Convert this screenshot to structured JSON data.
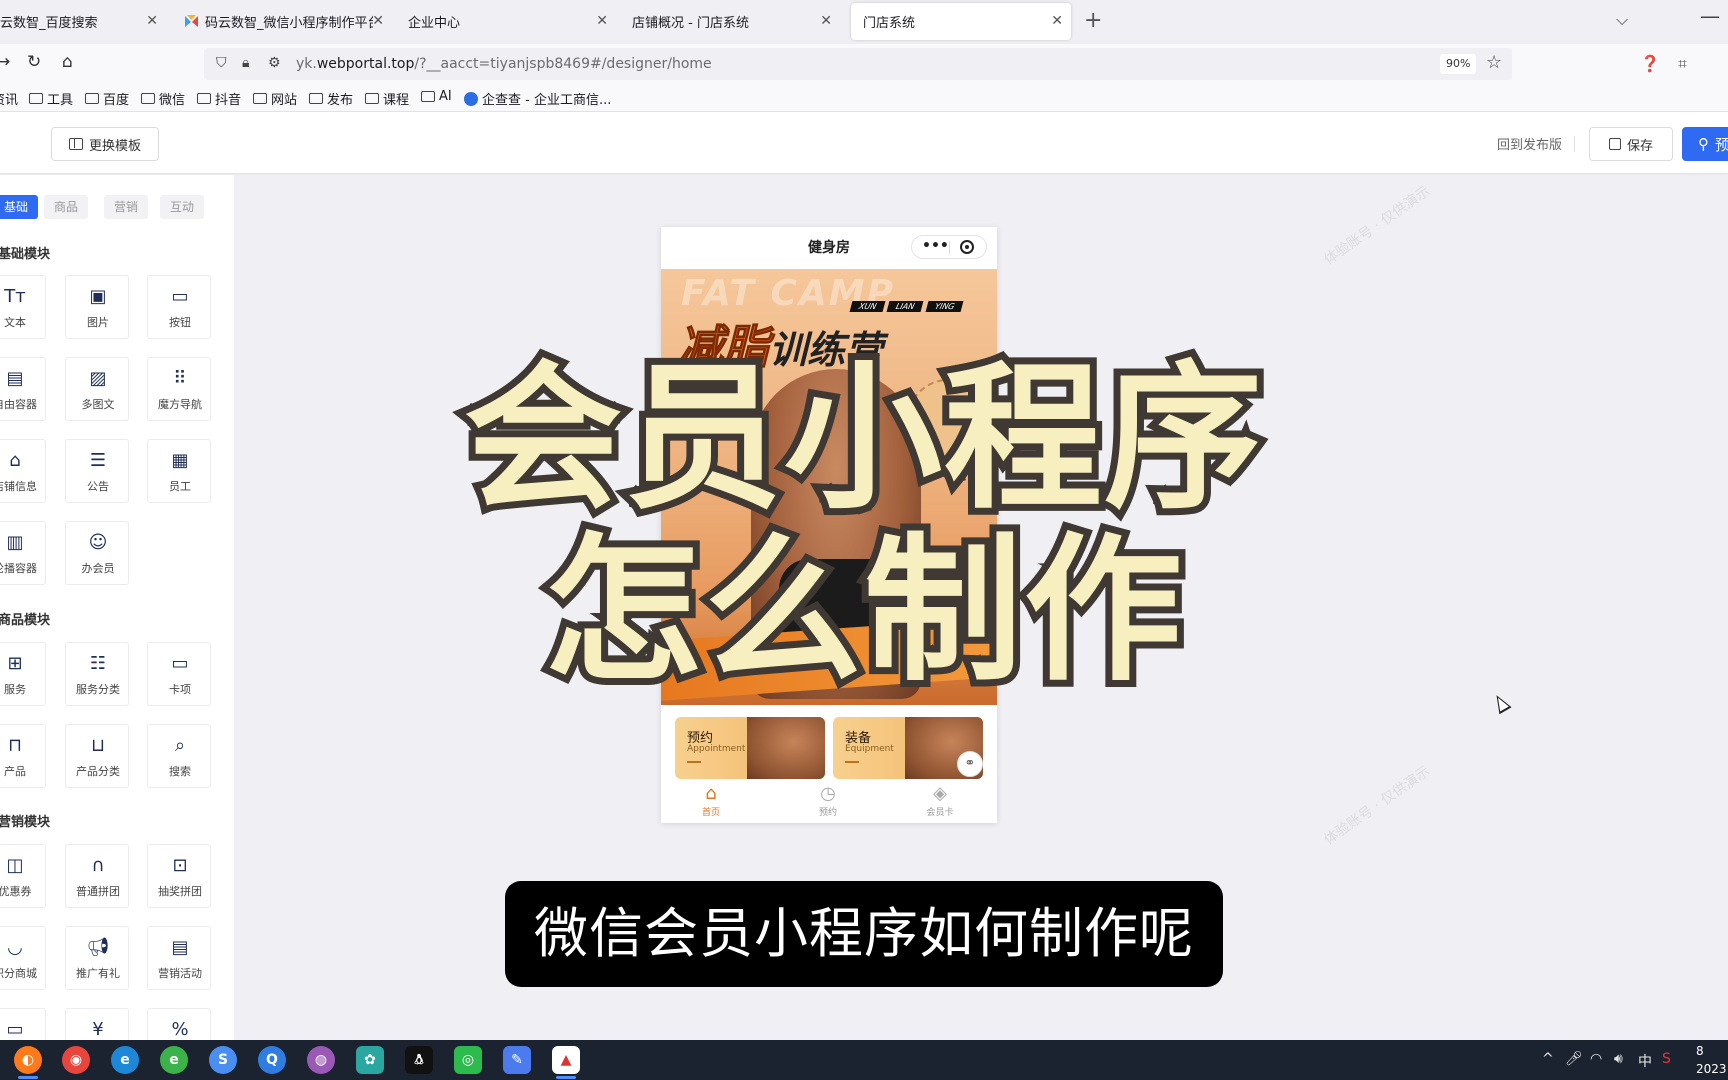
{
  "browser": {
    "tabs": [
      {
        "label": "云数智_百度搜索",
        "active": false
      },
      {
        "label": "码云数智_微信小程序制作平台_",
        "active": false
      },
      {
        "label": "企业中心",
        "active": false
      },
      {
        "label": "店铺概况 - 门店系统",
        "active": false
      },
      {
        "label": "门店系统",
        "active": true
      }
    ],
    "url_prefix": "yk.",
    "url_domain": "webportal.top",
    "url_path": "/?__aacct=tiyanjspb8469#/designer/home",
    "zoom": "90%",
    "bookmarks": [
      {
        "label": "资讯",
        "type": "folder"
      },
      {
        "label": "工具",
        "type": "folder"
      },
      {
        "label": "百度",
        "type": "folder"
      },
      {
        "label": "微信",
        "type": "folder"
      },
      {
        "label": "抖音",
        "type": "folder"
      },
      {
        "label": "网站",
        "type": "folder"
      },
      {
        "label": "发布",
        "type": "folder"
      },
      {
        "label": "课程",
        "type": "folder"
      },
      {
        "label": "AI",
        "type": "folder"
      },
      {
        "label": "企查查 - 企业工商信...",
        "type": "site"
      }
    ]
  },
  "header": {
    "template_button": "更换模板",
    "publish_link": "回到发布版",
    "save_button": "保存",
    "preview_button": "预"
  },
  "left_panel": {
    "tabs": [
      {
        "label": "基础",
        "active": true
      },
      {
        "label": "商品",
        "active": false
      },
      {
        "label": "营销",
        "active": false
      },
      {
        "label": "互动",
        "active": false
      }
    ],
    "sections": [
      {
        "title": "基础模块",
        "items": [
          {
            "label": "文本",
            "icon": "text-icon"
          },
          {
            "label": "图片",
            "icon": "image-icon"
          },
          {
            "label": "按钮",
            "icon": "button-icon"
          },
          {
            "label": "自由容器",
            "icon": "container-icon"
          },
          {
            "label": "多图文",
            "icon": "multi-image-icon"
          },
          {
            "label": "魔方导航",
            "icon": "grid-nav-icon"
          },
          {
            "label": "店铺信息",
            "icon": "store-icon"
          },
          {
            "label": "公告",
            "icon": "notice-icon"
          },
          {
            "label": "员工",
            "icon": "staff-card-icon"
          },
          {
            "label": "轮播容器",
            "icon": "carousel-icon"
          },
          {
            "label": "办会员",
            "icon": "member-icon"
          }
        ]
      },
      {
        "title": "商品模块",
        "items": [
          {
            "label": "服务",
            "icon": "service-grid-icon"
          },
          {
            "label": "服务分类",
            "icon": "service-category-icon"
          },
          {
            "label": "卡项",
            "icon": "card-icon"
          },
          {
            "label": "产品",
            "icon": "bag-icon"
          },
          {
            "label": "产品分类",
            "icon": "product-category-icon"
          },
          {
            "label": "搜索",
            "icon": "search-icon"
          }
        ]
      },
      {
        "title": "营销模块",
        "items": [
          {
            "label": "优惠券",
            "icon": "coupon-icon"
          },
          {
            "label": "普通拼团",
            "icon": "group-buy-icon"
          },
          {
            "label": "抽奖拼团",
            "icon": "gift-icon"
          },
          {
            "label": "积分商城",
            "icon": "points-mall-icon"
          },
          {
            "label": "推广有礼",
            "icon": "megaphone-icon"
          },
          {
            "label": "营销活动",
            "icon": "activity-icon"
          },
          {
            "label": "",
            "icon": "video-icon"
          },
          {
            "label": "",
            "icon": "price-tag-icon"
          },
          {
            "label": "",
            "icon": "discount-icon"
          }
        ]
      }
    ]
  },
  "phone": {
    "title": "健身房",
    "banner_bg_text": "FAT CAMP",
    "banner_tags": [
      "XUN",
      "LIAN",
      "YING"
    ],
    "banner_headline_1": "减脂",
    "banner_headline_2": "训练营",
    "cards": [
      {
        "title": "预约",
        "subtitle": "Appointment"
      },
      {
        "title": "装备",
        "subtitle": "Equipment"
      }
    ],
    "nav": [
      {
        "label": "首页",
        "icon": "home-icon",
        "active": true
      },
      {
        "label": "预约",
        "icon": "clock-icon",
        "active": false
      },
      {
        "label": "会员卡",
        "icon": "member-card-icon",
        "active": false
      }
    ]
  },
  "overlay": {
    "title_line1": "会员小程序",
    "title_line2": "怎么制作",
    "subtitle": "微信会员小程序如何制作呢"
  },
  "taskbar": {
    "tray_lang": "中",
    "clock_time": "8",
    "clock_date": "2023"
  }
}
